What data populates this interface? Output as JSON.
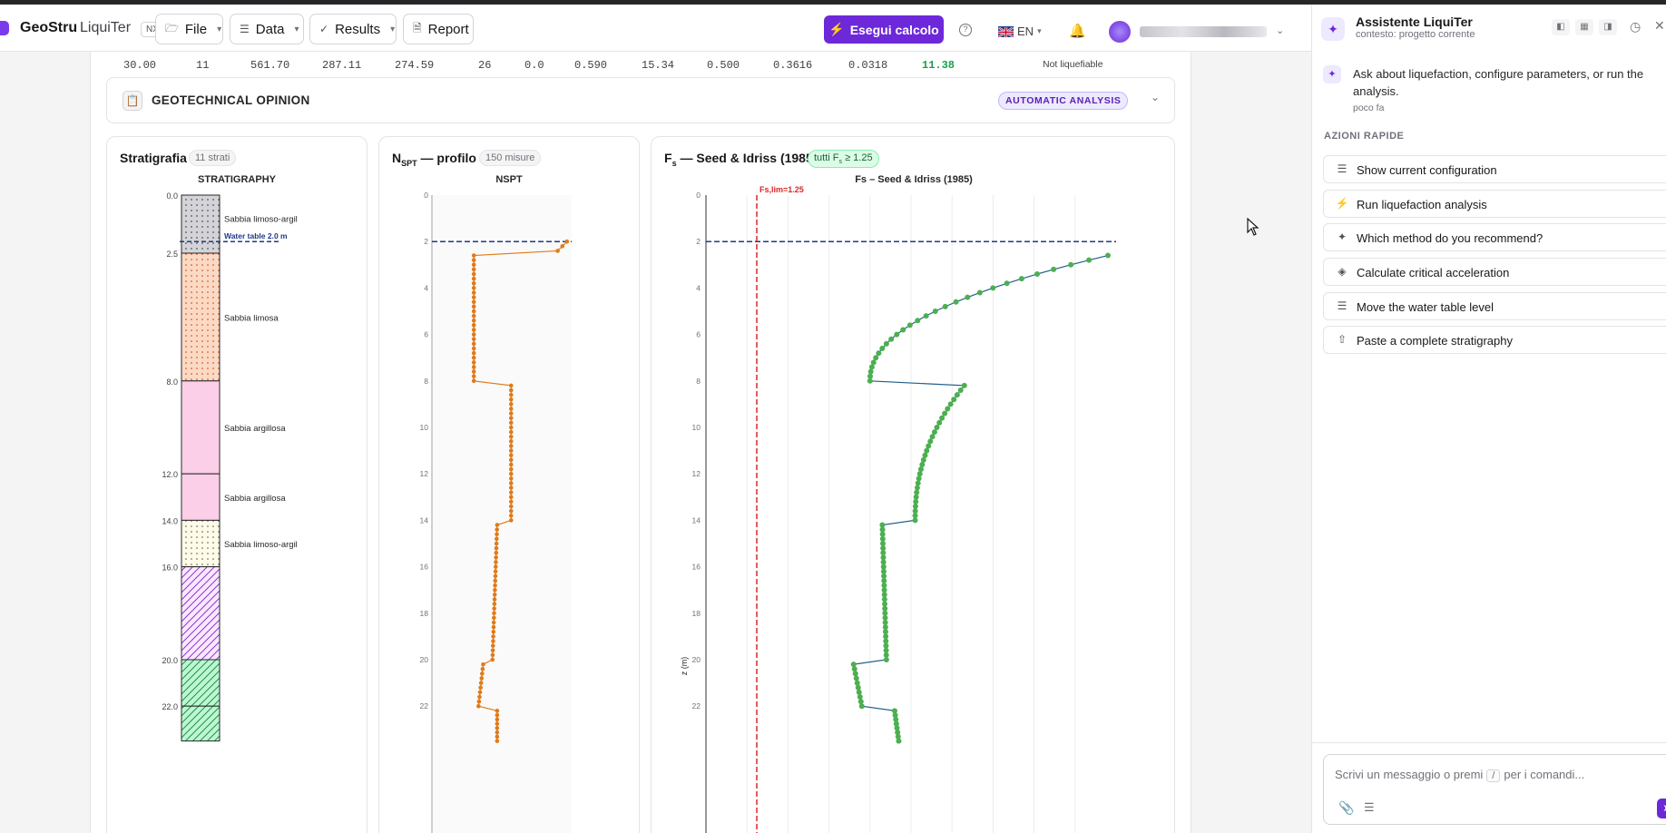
{
  "topbar": {
    "brand": "GeoStru",
    "product": "LiquiTer",
    "tag": "NX",
    "menus": [
      {
        "label": "File",
        "icon": "folder-icon"
      },
      {
        "label": "Data",
        "icon": "layers-icon"
      },
      {
        "label": "Results",
        "icon": "check-circle-icon"
      }
    ],
    "report_label": "Report",
    "run_label": "Esegui calcolo",
    "help": "?",
    "language": "EN"
  },
  "table_row": {
    "cells": [
      "30.00",
      "11",
      "561.70",
      "287.11",
      "274.59",
      "26",
      "0.0",
      "0.590",
      "15.34",
      "0.500",
      "0.3616",
      "0.0318",
      "11.38"
    ],
    "status": "Not liquefiable",
    "fs_color": "#16a34a"
  },
  "opinion": {
    "title": "GEOTECHNICAL OPINION",
    "badge": "AUTOMATIC ANALYSIS"
  },
  "stratigraphy": {
    "title": "Stratigrafia",
    "badge": "11 strati",
    "chart_title": "STRATIGRAPHY",
    "water_table_label": "Water table 2.0 m",
    "depth_labels": [
      "0.0",
      "2.5",
      "8.0",
      "12.0",
      "14.0",
      "16.0",
      "20.0",
      "22.0"
    ],
    "layers": [
      {
        "top": 0.0,
        "bottom": 2.5,
        "name": "Sabbia limoso-argil",
        "pattern": "dots-gray"
      },
      {
        "top": 2.5,
        "bottom": 8.0,
        "name": "Sabbia limosa",
        "pattern": "dots-peach"
      },
      {
        "top": 8.0,
        "bottom": 12.0,
        "name": "Sabbia argillosa",
        "pattern": "pink"
      },
      {
        "top": 12.0,
        "bottom": 14.0,
        "name": "Sabbia argillosa",
        "pattern": "pink"
      },
      {
        "top": 14.0,
        "bottom": 16.0,
        "name": "Sabbia limoso-argil",
        "pattern": "dots-yellow"
      },
      {
        "top": 16.0,
        "bottom": 20.0,
        "name": "",
        "pattern": "hatch-purple"
      },
      {
        "top": 20.0,
        "bottom": 22.0,
        "name": "",
        "pattern": "hatch-green"
      },
      {
        "top": 22.0,
        "bottom": 23.5,
        "name": "",
        "pattern": "hatch-green"
      }
    ]
  },
  "nspt": {
    "title": "N",
    "title_sub": "SPT",
    "title_rest": " — profilo",
    "badge": "150 misure",
    "chart_title": "NSPT",
    "water_table": 2.0,
    "y_ticks": [
      "0",
      "2",
      "4",
      "6",
      "8",
      "10",
      "12",
      "14",
      "16",
      "18",
      "20",
      "22"
    ]
  },
  "fs": {
    "title_main": "F",
    "title_sub": "s",
    "title_rest": " — Seed & Idriss (1985)",
    "badge_prefix": "tutti F",
    "badge_sub": "s",
    "badge_rest": " ≥ 1.25",
    "chart_title": "Fs – Seed & Idriss (1985)",
    "limit_label": "Fs,lim=1.25",
    "y_label": "z (m)",
    "water_table": 2.0,
    "y_ticks": [
      "0",
      "2",
      "4",
      "6",
      "8",
      "10",
      "12",
      "14",
      "16",
      "18",
      "20",
      "22"
    ]
  },
  "chart_data": [
    {
      "type": "line",
      "title": "NSPT",
      "ylabel": "",
      "ylim": [
        0,
        23.5
      ],
      "y_inverted": true,
      "grid": false,
      "segments": [
        {
          "z_from": 2.0,
          "z_to": 2.4,
          "n_from": 29,
          "n_to": 27
        },
        {
          "z_from": 2.6,
          "z_to": 8.0,
          "n_from": 9,
          "n_to": 9
        },
        {
          "z_from": 8.2,
          "z_to": 14.0,
          "n_from": 17,
          "n_to": 17
        },
        {
          "z_from": 14.2,
          "z_to": 20.0,
          "n_from": 14,
          "n_to": 13
        },
        {
          "z_from": 20.2,
          "z_to": 22.0,
          "n_from": 11,
          "n_to": 10
        },
        {
          "z_from": 22.2,
          "z_to": 23.5,
          "n_from": 14,
          "n_to": 14
        }
      ],
      "color": "#e07b1a"
    },
    {
      "type": "scatter",
      "title": "Fs – Seed & Idriss (1985)",
      "ylabel": "z (m)",
      "ylim": [
        0,
        23.5
      ],
      "y_inverted": true,
      "grid": true,
      "limit": 1.25,
      "segments": [
        {
          "z_from": 2.6,
          "z_to": 8.0,
          "fs_from": 9.8,
          "fs_to": 4.0,
          "shape": "curve"
        },
        {
          "z_from": 8.2,
          "z_to": 14.0,
          "fs_from": 6.3,
          "fs_to": 5.1,
          "shape": "curve"
        },
        {
          "z_from": 14.2,
          "z_to": 20.0,
          "fs_from": 4.3,
          "fs_to": 4.4,
          "shape": "straight"
        },
        {
          "z_from": 20.2,
          "z_to": 22.0,
          "fs_from": 3.6,
          "fs_to": 3.8,
          "shape": "straight"
        },
        {
          "z_from": 22.2,
          "z_to": 23.5,
          "fs_from": 4.6,
          "fs_to": 4.7,
          "shape": "straight"
        }
      ],
      "color": "#4caf50",
      "line_color": "#1f5f8b"
    }
  ],
  "assistant": {
    "title": "Assistente LiquiTer",
    "context": "contesto: progetto corrente",
    "message": "Ask about liquefaction, configure parameters, or run the analysis.",
    "message_time": "poco fa",
    "quick_label": "AZIONI RAPIDE",
    "quick_actions": [
      {
        "label": "Show current configuration",
        "icon": "layers-icon"
      },
      {
        "label": "Run liquefaction analysis",
        "icon": "lightning-icon"
      },
      {
        "label": "Which method do you recommend?",
        "icon": "sparkle-icon"
      },
      {
        "label": "Calculate critical acceleration",
        "icon": "gem-icon"
      },
      {
        "label": "Move the water table level",
        "icon": "layers-icon"
      },
      {
        "label": "Paste a complete stratigraphy",
        "icon": "upload-icon"
      }
    ],
    "composer_before": "Scrivi un messaggio o premi",
    "composer_key": "/",
    "composer_after": "per i comandi..."
  }
}
